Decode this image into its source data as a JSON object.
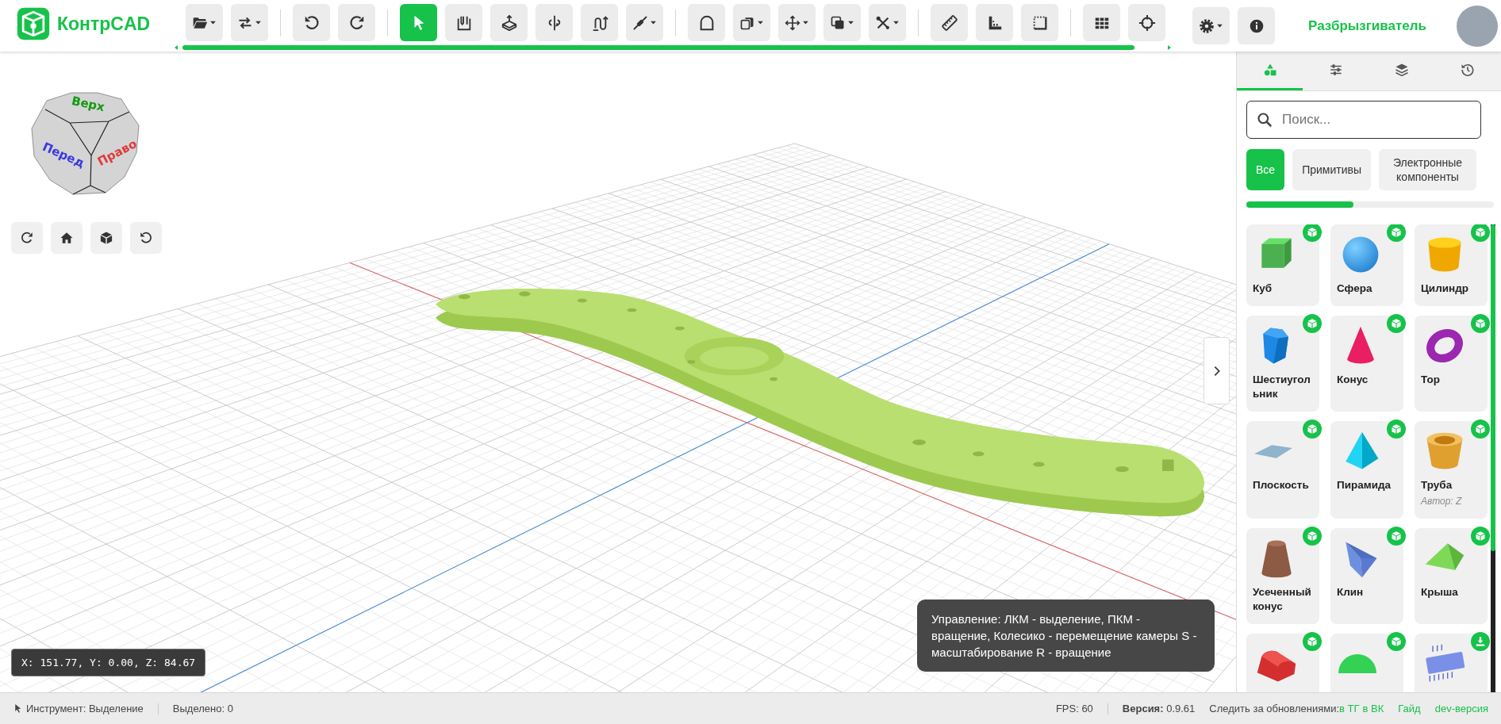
{
  "header": {
    "logo": "КонтрCAD",
    "tool_groups": [
      {
        "tools": [
          {
            "menu": true,
            "selected": false
          },
          {
            "menu": true,
            "selected": false
          }
        ]
      },
      {
        "tools": [
          {
            "menu": false,
            "selected": false
          },
          {
            "menu": false,
            "selected": false
          }
        ]
      },
      {
        "tools": [
          {
            "menu": false,
            "selected": true
          },
          {
            "menu": false,
            "selected": false
          },
          {
            "menu": false,
            "selected": false
          },
          {
            "menu": false,
            "selected": false
          },
          {
            "menu": false,
            "selected": false
          },
          {
            "menu": true,
            "selected": false
          }
        ]
      },
      {
        "tools": [
          {
            "menu": false,
            "selected": false
          },
          {
            "menu": true,
            "selected": false
          },
          {
            "menu": true,
            "selected": false
          },
          {
            "menu": true,
            "selected": false
          },
          {
            "menu": true,
            "selected": false
          }
        ]
      },
      {
        "tools": [
          {
            "menu": false,
            "selected": false
          },
          {
            "menu": false,
            "selected": false
          },
          {
            "menu": false,
            "selected": false
          }
        ]
      },
      {
        "tools": [
          {
            "menu": false,
            "selected": false
          },
          {
            "menu": false,
            "selected": false
          }
        ]
      }
    ],
    "settings": {
      "menu": true
    },
    "user_name": "Разбрызгиватель"
  },
  "viewport": {
    "view_cube": {
      "faces": [
        {
          "label": "Верх",
          "color": "#149a14"
        },
        {
          "label": "Перед",
          "color": "#3a3ae0"
        },
        {
          "label": "Право",
          "color": "#e03a3a"
        }
      ]
    },
    "coordinates": "X: 151.77, Y: 0.00, Z: 84.67",
    "hint": "Управление: ЛКМ - выделение, ПКМ - вращение, Колесико - перемещение камеры S - масштабирование R - вращение"
  },
  "side_panel": {
    "tabs": [
      {
        "selected": true
      },
      {
        "selected": false
      },
      {
        "selected": false
      },
      {
        "selected": false
      }
    ],
    "search": {
      "placeholder": "Поиск..."
    },
    "filters": [
      {
        "label": "Все",
        "selected": true
      },
      {
        "label": "Примитивы",
        "selected": false
      },
      {
        "label": "Электронные компоненты",
        "selected": false
      }
    ],
    "items": [
      {
        "label": "Куб",
        "kind": "add"
      },
      {
        "label": "Сфера",
        "kind": "add"
      },
      {
        "label": "Цилиндр",
        "kind": "add"
      },
      {
        "label": "Шестиугольник",
        "kind": "add"
      },
      {
        "label": "Конус",
        "kind": "add"
      },
      {
        "label": "Тор",
        "kind": "add"
      },
      {
        "label": "Плоскость",
        "kind": "add"
      },
      {
        "label": "Пирамида",
        "kind": "add"
      },
      {
        "label": "Труба",
        "author": "Автор: Z",
        "kind": "add"
      },
      {
        "label": "Усеченный конус",
        "kind": "add"
      },
      {
        "label": "Клин",
        "kind": "add"
      },
      {
        "label": "Крыша",
        "kind": "add"
      },
      {
        "kind": "add"
      },
      {
        "kind": "add"
      },
      {
        "kind": "download"
      }
    ]
  },
  "status_bar": {
    "tool": "Инструмент: Выделение",
    "selected_count": "Выделено: 0",
    "fps": "FPS: 60",
    "version": "**Версия:** 0.9.61",
    "follow": "Следить за обновлениями:",
    "links": [
      "в ТГ",
      "в ВК",
      "Гайд",
      "dev-версия"
    ]
  }
}
